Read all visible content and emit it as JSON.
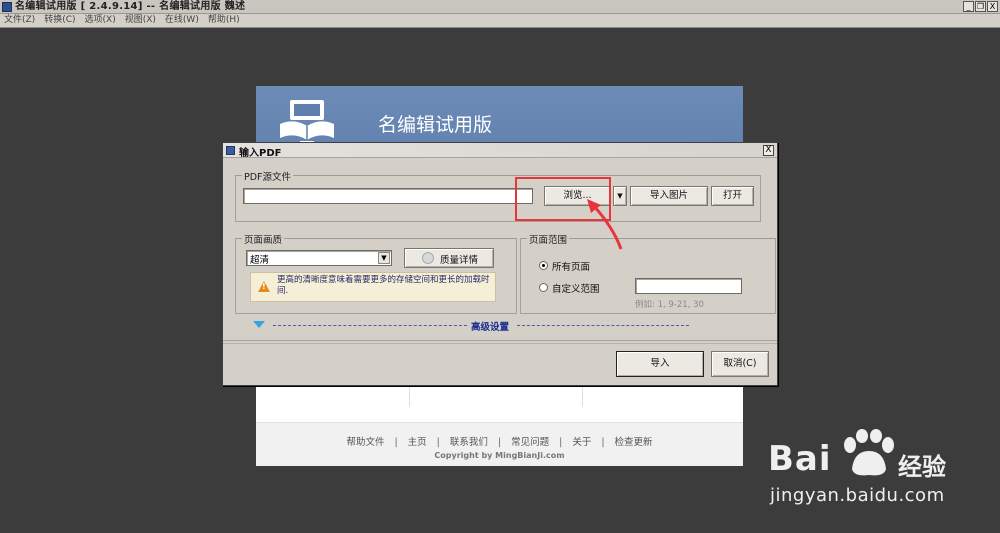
{
  "window": {
    "title": "名编辑试用版 [ 2.4.9.14] -- 名编辑试用版 魏述",
    "minimize_label": "_",
    "restore_label": "❐",
    "close_label": "X"
  },
  "menubar": [
    "文件(Z)",
    "转换(C)",
    "选项(X)",
    "视图(X)",
    "在线(W)",
    "帮助(H)"
  ],
  "background_app": {
    "header_title": "名编辑试用版",
    "footer_links": [
      "帮助文件",
      "主页",
      "联系我们",
      "常见问题",
      "关于",
      "检查更新"
    ],
    "footer_separator": "|",
    "copyright": "Copyright by MingBianJi.com",
    "header_color": "#6482b0"
  },
  "dialog": {
    "title": "输入PDF",
    "close_label": "X",
    "source": {
      "legend": "PDF源文件",
      "path_value": "",
      "browse_label": "浏览...",
      "dropdown_arrow": "▼",
      "import_image_label": "导入图片",
      "open_label": "打开"
    },
    "quality": {
      "legend": "页面画质",
      "selected": "超清",
      "details_label": "质量详情",
      "warning": "更高的清晰度意味着需要更多的存储空间和更长的加载时间."
    },
    "range": {
      "legend": "页面范围",
      "all_pages_label": "所有页面",
      "custom_label": "自定义范围",
      "custom_value": "",
      "example": "例如: 1, 9-21, 30",
      "selected": "所有页面"
    },
    "advanced_label": "高级设置",
    "import_label": "导入",
    "cancel_label": "取消(C)"
  },
  "annotation": {
    "highlight_color": "#e8353b"
  },
  "watermark": {
    "brand": "Bai",
    "brand_du": "du",
    "brand_cn": "经验",
    "url": "jingyan.baidu.com"
  }
}
